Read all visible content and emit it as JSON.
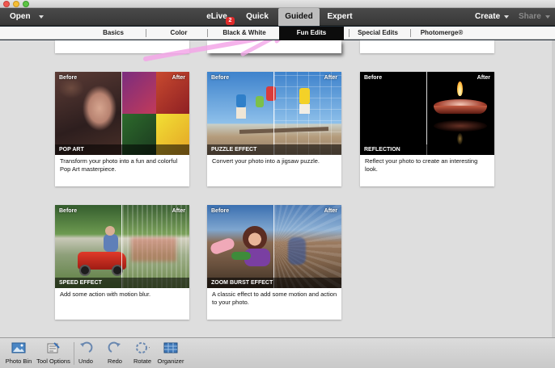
{
  "topbar": {
    "open_label": "Open",
    "modes": [
      {
        "label": "eLive",
        "badge": "2"
      },
      {
        "label": "Quick"
      },
      {
        "label": "Guided",
        "active": true
      },
      {
        "label": "Expert"
      }
    ],
    "create_label": "Create",
    "share_label": "Share"
  },
  "subtabs": [
    {
      "label": "Basics"
    },
    {
      "label": "Color"
    },
    {
      "label": "Black & White"
    },
    {
      "label": "Fun Edits",
      "active": true
    },
    {
      "label": "Special Edits"
    },
    {
      "label": "Photomerge®"
    }
  ],
  "cards": [
    {
      "title": "POP ART",
      "before": "Before",
      "after": "After",
      "description": "Transform your photo into a fun and colorful Pop Art masterpiece."
    },
    {
      "title": "PUZZLE EFFECT",
      "before": "Before",
      "after": "After",
      "description": "Convert your photo into a jigsaw puzzle."
    },
    {
      "title": "REFLECTION",
      "before": "Before",
      "after": "After",
      "description": "Reflect your photo to create an interesting look."
    },
    {
      "title": "SPEED EFFECT",
      "before": "Before",
      "after": "After",
      "description": "Add some action with motion blur."
    },
    {
      "title": "ZOOM BURST EFFECT",
      "before": "Before",
      "after": "After",
      "description": "A classic effect to add some motion and action to your photo."
    }
  ],
  "bottombar": {
    "tools": [
      {
        "label": "Photo Bin",
        "icon": "photo-bin-icon"
      },
      {
        "label": "Tool Options",
        "icon": "tool-options-icon"
      },
      {
        "label": "Undo",
        "icon": "undo-icon"
      },
      {
        "label": "Redo",
        "icon": "redo-icon"
      },
      {
        "label": "Rotate",
        "icon": "rotate-icon"
      },
      {
        "label": "Organizer",
        "icon": "organizer-icon"
      }
    ]
  },
  "colors": {
    "topbar_bg": "#3f3f3f",
    "active_mode_bg": "#bdbdbd",
    "active_subtab_bg": "#0c0c0c",
    "badge_red": "#e02a2a",
    "content_bg": "#dedede",
    "annotation_pink": "#f3a6e8"
  }
}
